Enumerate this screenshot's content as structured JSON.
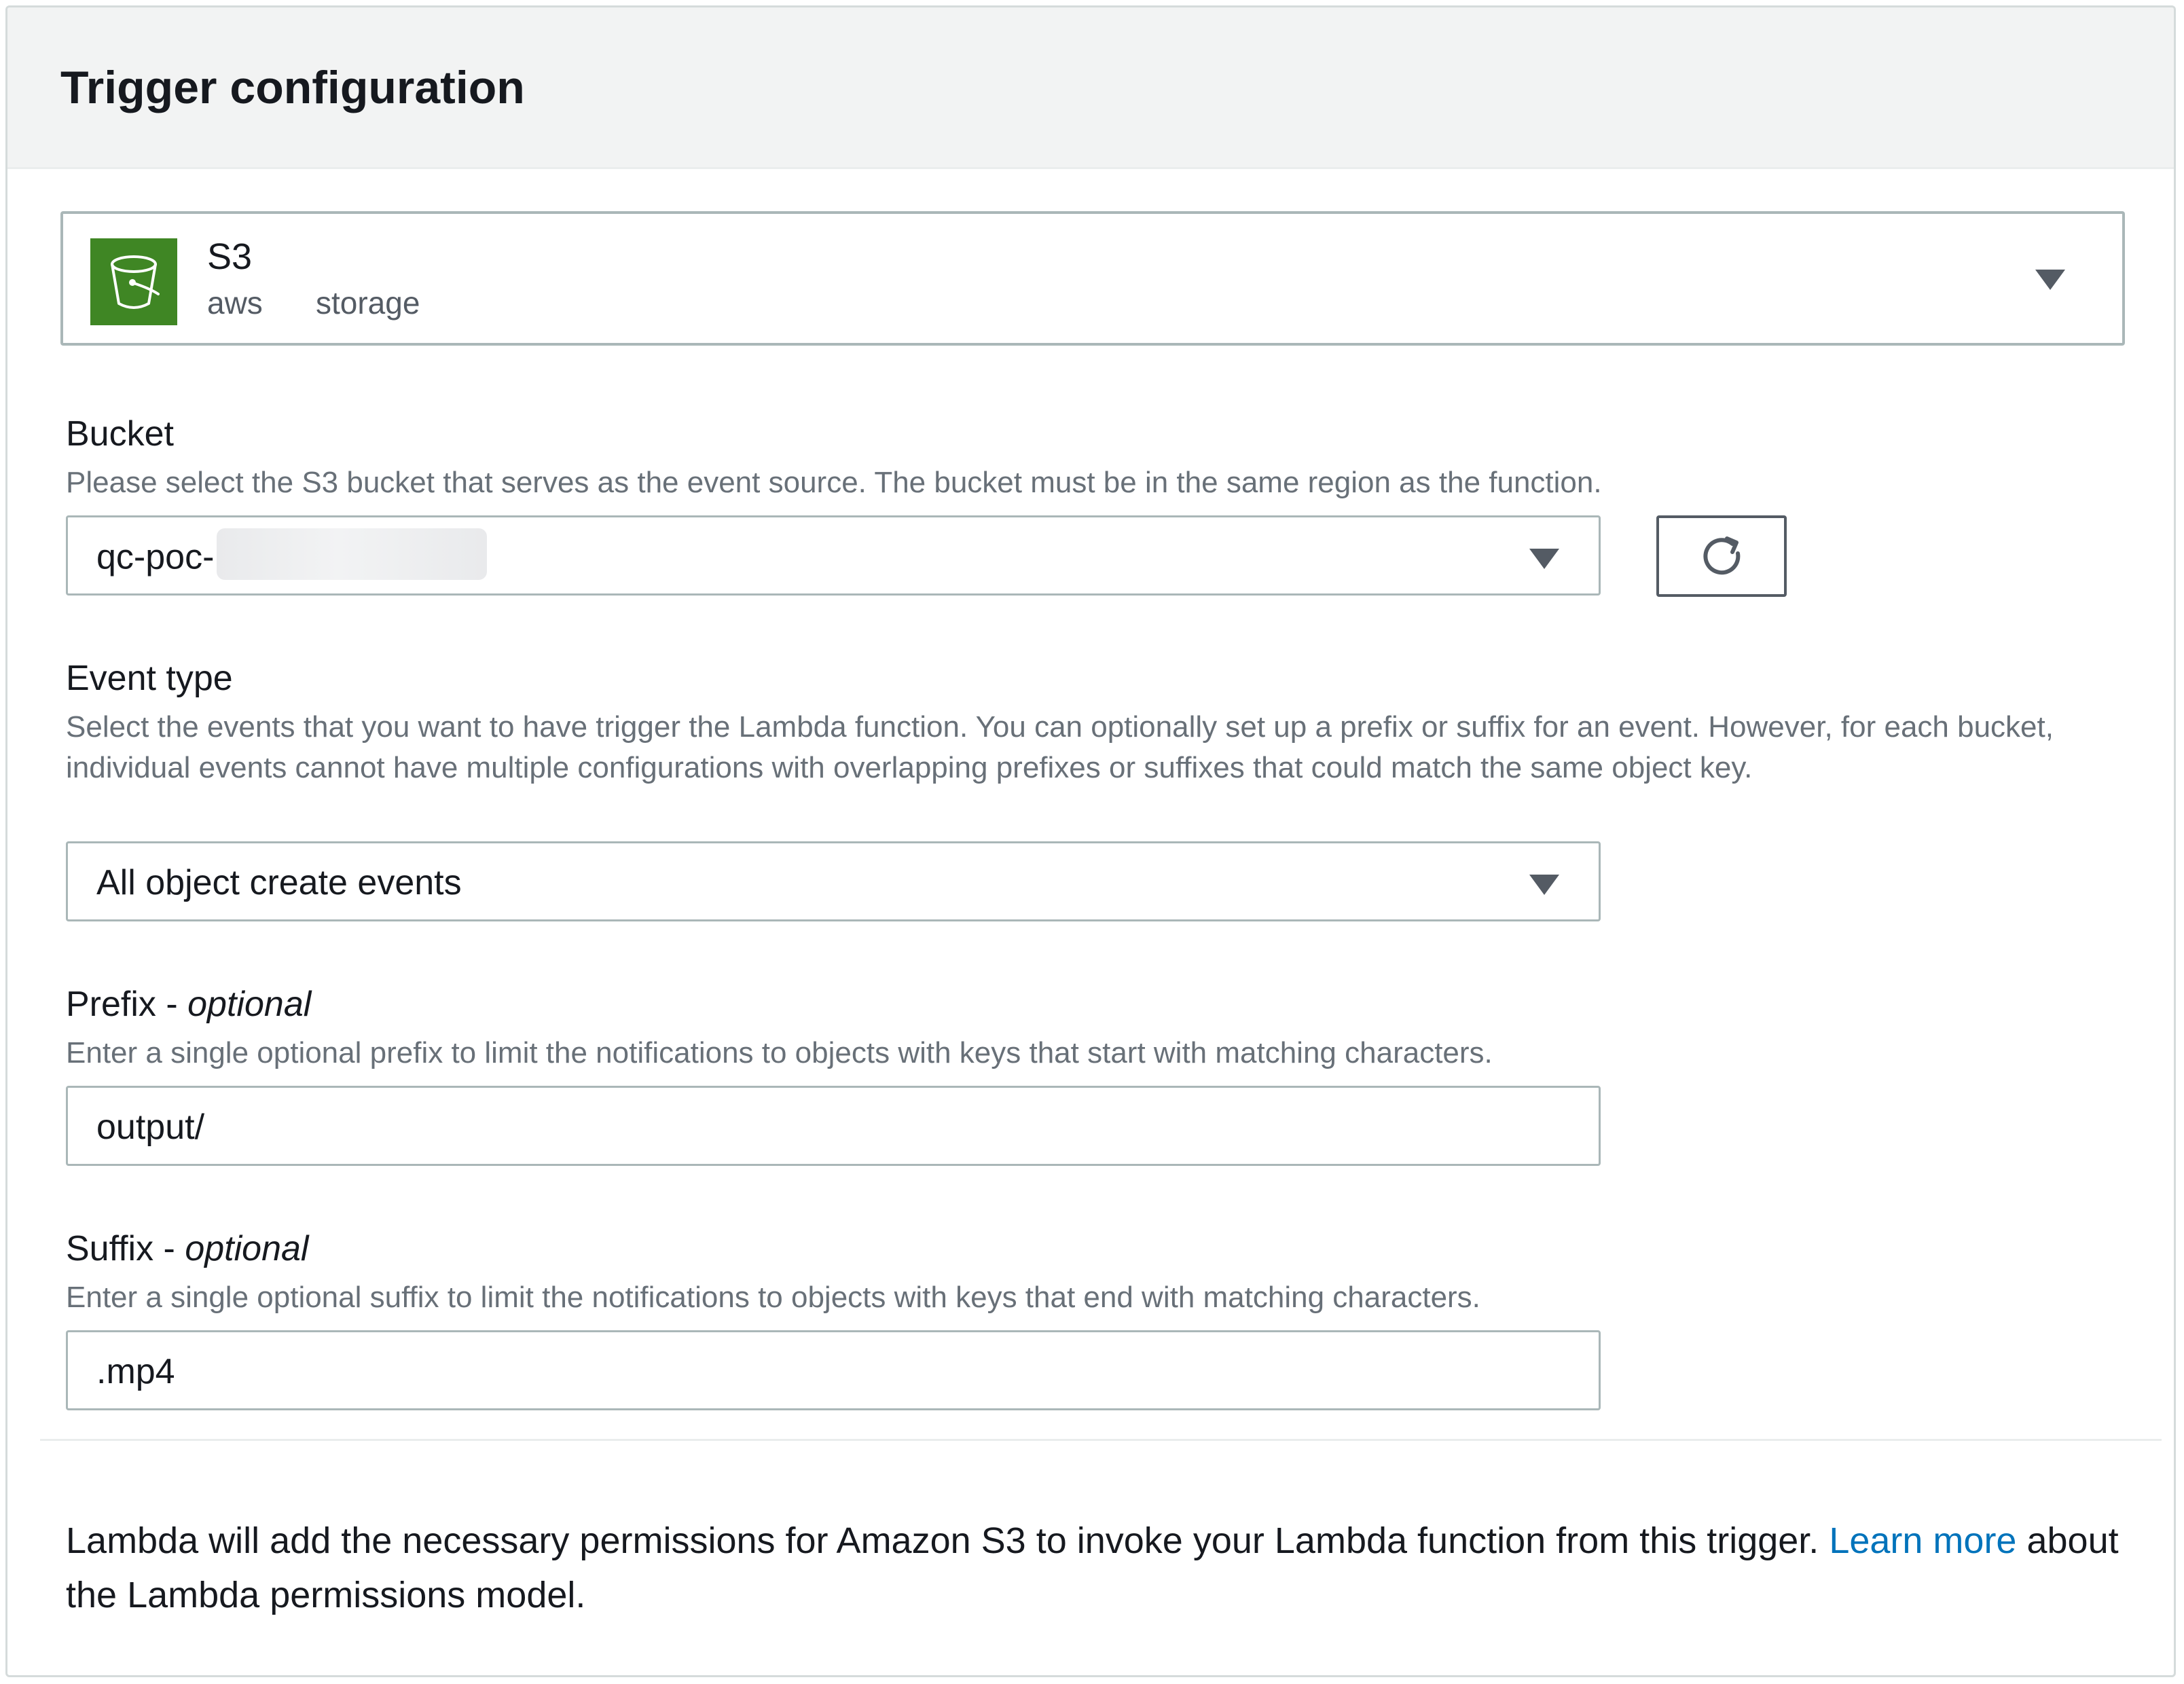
{
  "panel": {
    "title": "Trigger configuration"
  },
  "service": {
    "name": "S3",
    "tags": [
      "aws",
      "storage"
    ],
    "icon": "s3-bucket-icon",
    "icon_color": "#3f8624"
  },
  "bucket": {
    "label": "Bucket",
    "description": "Please select the S3 bucket that serves as the event source. The bucket must be in the same region as the function.",
    "value_visible": "qc-poc-",
    "refresh_icon": "refresh-icon"
  },
  "event_type": {
    "label": "Event type",
    "description": "Select the events that you want to have trigger the Lambda function. You can optionally set up a prefix or suffix for an event. However, for each bucket, individual events cannot have multiple configurations with overlapping prefixes or suffixes that could match the same object key.",
    "value": "All object create events"
  },
  "prefix": {
    "label": "Prefix - ",
    "label_optional": "optional",
    "description": "Enter a single optional prefix to limit the notifications to objects with keys that start with matching characters.",
    "value": "output/"
  },
  "suffix": {
    "label": "Suffix - ",
    "label_optional": "optional",
    "description": "Enter a single optional suffix to limit the notifications to objects with keys that end with matching characters.",
    "value": ".mp4"
  },
  "footer": {
    "text_before": "Lambda will add the necessary permissions for Amazon S3 to invoke your Lambda function from this trigger. ",
    "link_text": "Learn more",
    "text_after": " about the Lambda permissions model.",
    "link_color": "#0073bb"
  }
}
